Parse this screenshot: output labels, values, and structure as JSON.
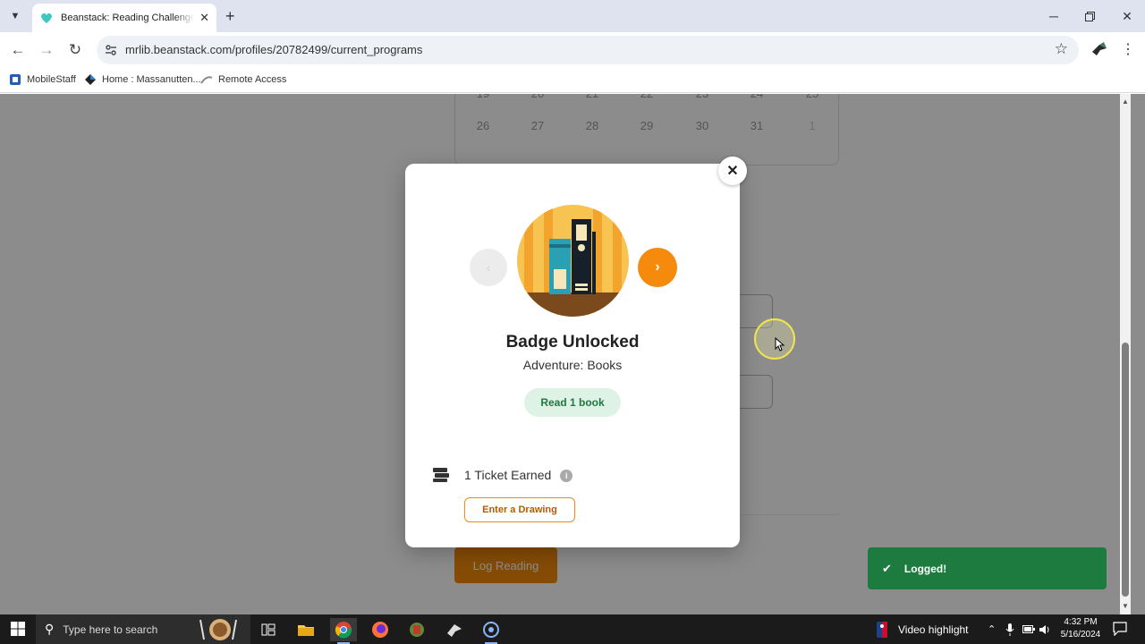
{
  "browser": {
    "tab_title": "Beanstack: Reading Challenges and",
    "tab_close": "✕",
    "new_tab": "+",
    "url": "mrlib.beanstack.com/profiles/20782499/current_programs",
    "bookmarks": [
      {
        "label": "MobileStaff"
      },
      {
        "label": "Home : Massanutten..."
      },
      {
        "label": "Remote Access"
      }
    ]
  },
  "calendar": {
    "row1": [
      "19",
      "20",
      "21",
      "22",
      "23",
      "24",
      "25"
    ],
    "row2": [
      "26",
      "27",
      "28",
      "29",
      "30",
      "31",
      "1"
    ]
  },
  "page": {
    "log_reading": "Log Reading"
  },
  "modal": {
    "close": "✕",
    "title": "Badge Unlocked",
    "subtitle": "Adventure: Books",
    "requirement": "Read 1 book",
    "tickets": "1 Ticket Earned",
    "info": "i",
    "enter_drawing": "Enter a Drawing"
  },
  "toast": {
    "message": "Logged!"
  },
  "taskbar": {
    "search_placeholder": "Type here to search",
    "video_highlight": "Video highlight",
    "time": "4:32 PM",
    "date": "5/16/2024"
  },
  "colors": {
    "accent_orange": "#f58a0c",
    "toast_green": "#1e7b3f",
    "pill_green_bg": "#dff2e6"
  }
}
